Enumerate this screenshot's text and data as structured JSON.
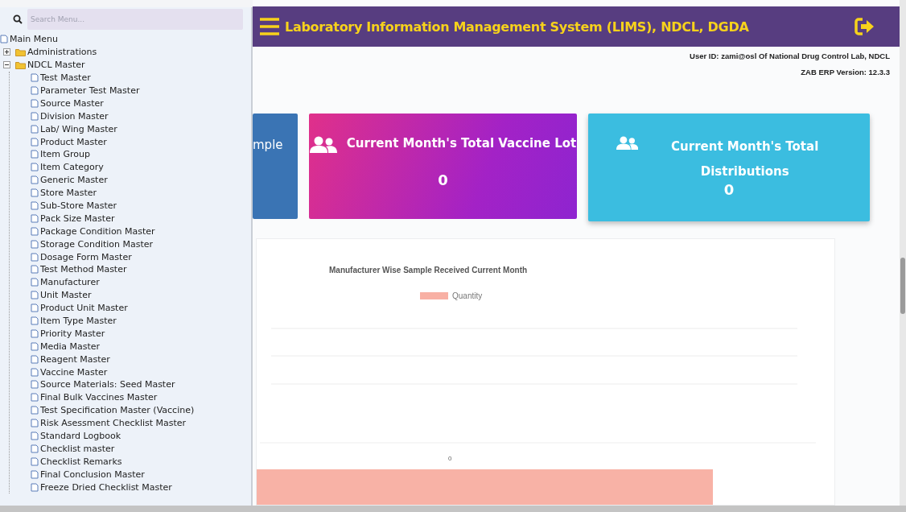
{
  "sidebar": {
    "search": {
      "placeholder": "Search Menu..."
    },
    "tree": [
      {
        "label": "Main Menu",
        "kind": "root",
        "children": [
          {
            "label": "Administrations",
            "kind": "folder",
            "expanded": false
          },
          {
            "label": "NDCL Master",
            "kind": "folder",
            "expanded": true,
            "children": [
              {
                "label": "Test Master",
                "kind": "page"
              },
              {
                "label": "Parameter Test Master",
                "kind": "page"
              },
              {
                "label": "Source Master",
                "kind": "page"
              },
              {
                "label": "Division Master",
                "kind": "page"
              },
              {
                "label": "Lab/ Wing Master",
                "kind": "page"
              },
              {
                "label": "Product Master",
                "kind": "page"
              },
              {
                "label": "Item Group",
                "kind": "page"
              },
              {
                "label": "Item Category",
                "kind": "page"
              },
              {
                "label": "Generic Master",
                "kind": "page"
              },
              {
                "label": "Store Master",
                "kind": "page"
              },
              {
                "label": "Sub-Store Master",
                "kind": "page"
              },
              {
                "label": "Pack Size Master",
                "kind": "page"
              },
              {
                "label": "Package Condition Master",
                "kind": "page"
              },
              {
                "label": "Storage Condition Master",
                "kind": "page"
              },
              {
                "label": "Dosage Form Master",
                "kind": "page"
              },
              {
                "label": "Test Method Master",
                "kind": "page"
              },
              {
                "label": "Manufacturer",
                "kind": "page"
              },
              {
                "label": "Unit Master",
                "kind": "page"
              },
              {
                "label": "Product Unit Master",
                "kind": "page"
              },
              {
                "label": "Item Type Master",
                "kind": "page"
              },
              {
                "label": "Priority Master",
                "kind": "page"
              },
              {
                "label": "Media Master",
                "kind": "page"
              },
              {
                "label": "Reagent Master",
                "kind": "page"
              },
              {
                "label": "Vaccine Master",
                "kind": "page"
              },
              {
                "label": "Source Materials: Seed Master",
                "kind": "page"
              },
              {
                "label": "Final Bulk Vaccines Master",
                "kind": "page"
              },
              {
                "label": "Test Specification Master (Vaccine)",
                "kind": "page"
              },
              {
                "label": "Risk Asessment Checklist Master",
                "kind": "page"
              },
              {
                "label": "Standard Logbook",
                "kind": "page"
              },
              {
                "label": "Checklist master",
                "kind": "page"
              },
              {
                "label": "Checklist Remarks",
                "kind": "page"
              },
              {
                "label": "Final Conclusion Master",
                "kind": "page"
              },
              {
                "label": "Freeze Dried Checklist Master",
                "kind": "page"
              }
            ]
          }
        ]
      }
    ]
  },
  "header": {
    "title": "Laboratory Information Management System (LIMS), NDCL, DGDA"
  },
  "user_info": {
    "user_id": "User ID: zami@osl Of National Drug Control Lab, NDCL",
    "version": "ZAB ERP Version: 12.3.3"
  },
  "cards": [
    {
      "title": "mple",
      "kind": "partial",
      "color": "#3a74b4"
    },
    {
      "title": "Current Month's Total Vaccine Lot",
      "value": "0",
      "kind": "gradient",
      "color": "#e0308a"
    },
    {
      "title": "Current Month's Total Distributions",
      "value": "0",
      "kind": "plain",
      "color": "#3bbde0"
    }
  ],
  "chart": {
    "title": "Manufacturer Wise Sample Received  Current Month",
    "legend": "Quantity",
    "tick": "0"
  }
}
